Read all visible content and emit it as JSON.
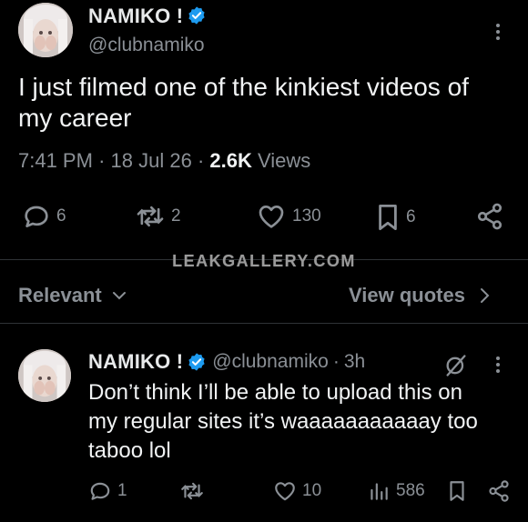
{
  "post": {
    "author_name": "NAMIKO !",
    "handle": "@clubnamiko",
    "text_line1": "I just filmed one of the kinkiest videos of",
    "text_line2": "my career",
    "time": "7:41 PM",
    "sep1": "·",
    "date": "18 Jul 26",
    "sep2": "·",
    "views_count": "2.6K",
    "views_label": "Views",
    "actions": {
      "replies": "6",
      "reposts": "2",
      "likes": "130",
      "bookmarks": "6"
    }
  },
  "watermark": "LEAKGALLERY.COM",
  "sort": {
    "relevant_label": "Relevant",
    "view_quotes_label": "View quotes"
  },
  "reply": {
    "author_name": "NAMIKO !",
    "handle": "@clubnamiko",
    "sep": "·",
    "age": "3h",
    "text_line1": "Don’t think I’ll be able to upload this on",
    "text_line2": "my regular sites it’s waaaaaaaaaaay too",
    "text_line3": "taboo lol",
    "actions": {
      "replies": "1",
      "likes": "10",
      "views": "586"
    }
  },
  "colors": {
    "background": "#000000",
    "text": "#e7e9ea",
    "muted": "#8b9096",
    "verified": "#1d9bf0"
  }
}
